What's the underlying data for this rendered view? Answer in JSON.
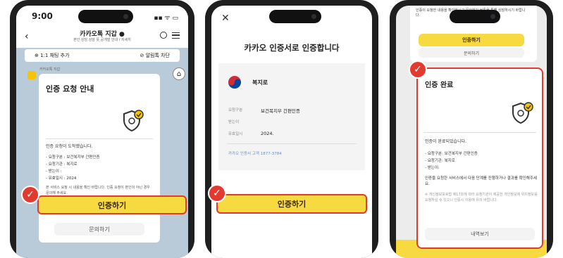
{
  "colors": {
    "accent": "#f7d940",
    "highlight": "#e23a2e",
    "chat_bg": "#b9cbd9"
  },
  "phone1": {
    "status_time": "9:00",
    "status_icons": "▪▪ ᯤ ▭",
    "back_icon": "chevron-left-icon",
    "channel_name": "카카오톡 지갑 ●",
    "channel_sub": "본인·상담 상담 뜻 공개발 안내 / 자세히",
    "search_icon": "search-icon",
    "menu_icon": "menu-icon",
    "tab_left": "⊕ 1:1 채팅 추가",
    "tab_right": "⊘ 알림톡 차단",
    "sender": "카카오톡 지갑",
    "home_icon": "home-icon",
    "card_title": "인증 요청 안내",
    "card_line1": "인증 요청이 도착했습니다.",
    "card_line2": "- 요청구분 : 보건복지부 간편인증",
    "card_line3": "- 요청기관 : 복지로",
    "card_line4": "- 받는이 :",
    "card_line5": "- 유효일시 : 2024",
    "card_note": "본 서비스 요청 시 내용을 확인 바랍니다. 인증 요청이 본인이 아닌 경우 문의해 주세요.",
    "primary_button": "인증하기",
    "secondary_button": "문의하기"
  },
  "phone2": {
    "close_icon": "close-icon",
    "title": "카카오 인증서로 인증합니다",
    "org_name": "복지로",
    "rows": [
      {
        "label": "요청구분",
        "value": "보건복지부 간편인증"
      },
      {
        "label": "받는이",
        "value": ""
      },
      {
        "label": "유효일시",
        "value": "2024."
      }
    ],
    "help_text": "카카오 인증서 고객 1877-3784",
    "primary_button": "인증하기"
  },
  "phone3": {
    "top_text": "인증이 요청한 내용을 확인하시고 문의하기 버튼을 통해 상담하시기 바랍니다.",
    "top_button": "인증하기",
    "top_button2": "문의하기",
    "card_title": "인증 완료",
    "line1": "인증이 완료되었습니다.",
    "line2": "- 요청구분: 보건복지부 간편인증",
    "line3": "- 요청기관: 복지로",
    "line4": "- 받는이:",
    "line5": "인증을 요청한 서비스에서 다음 단계를 진행하거나 결과를 확인해주세요.",
    "note": "※ 개인정보보호법 제17조에 따라 요청기관이 제공한 개인정보에 위치정보를 요청하실 수 있으니 인증시 이용에 유의 바랍니다.",
    "button": "내역보기"
  }
}
